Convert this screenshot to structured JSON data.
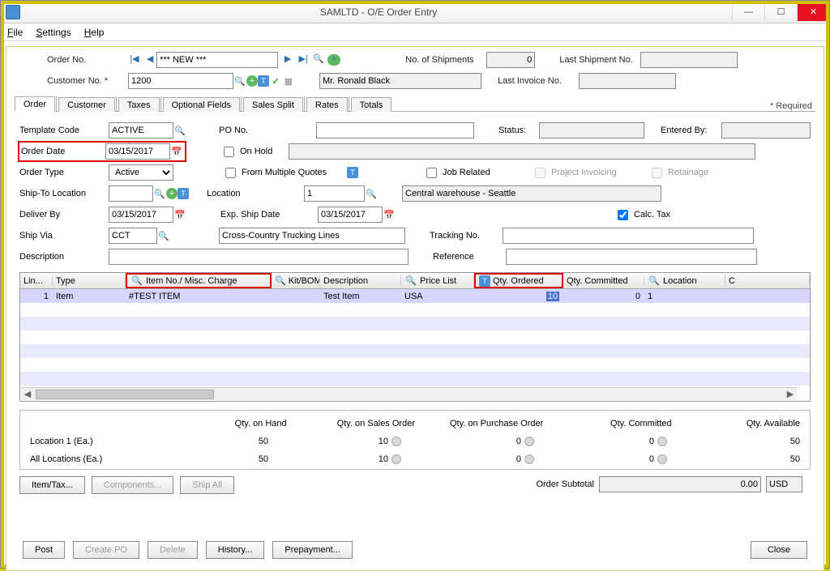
{
  "window": {
    "title": "SAMLTD - O/E Order Entry"
  },
  "menu": {
    "file": "File",
    "settings": "Settings",
    "help": "Help"
  },
  "header": {
    "order_no_label": "Order No.",
    "order_no_value": "*** NEW ***",
    "shipments_label": "No. of Shipments",
    "shipments_value": "0",
    "last_shipment_label": "Last Shipment No.",
    "last_shipment_value": "",
    "customer_no_label": "Customer No. *",
    "customer_no_value": "1200",
    "customer_name": "Mr. Ronald Black",
    "last_invoice_label": "Last Invoice No.",
    "last_invoice_value": ""
  },
  "required_label": "* Required",
  "tabs": [
    "Order",
    "Customer",
    "Taxes",
    "Optional Fields",
    "Sales Split",
    "Rates",
    "Totals"
  ],
  "order_tab": {
    "template_code_label": "Template Code",
    "template_code_value": "ACTIVE",
    "po_no_label": "PO No.",
    "po_no_value": "",
    "status_label": "Status:",
    "status_value": "",
    "entered_by_label": "Entered By:",
    "entered_by_value": "",
    "order_date_label": "Order Date",
    "order_date_value": "03/15/2017",
    "on_hold_label": "On Hold",
    "on_hold_value": "",
    "order_type_label": "Order Type",
    "order_type_value": "Active",
    "from_multiple_label": "From Multiple Quotes",
    "job_related_label": "Job Related",
    "project_invoicing_label": "Project Invoicing",
    "retainage_label": "Retainage",
    "ship_to_label": "Ship-To Location",
    "ship_to_value": "",
    "location_label": "Location",
    "location_value": "1",
    "location_name": "Central warehouse - Seattle",
    "deliver_by_label": "Deliver By",
    "deliver_by_value": "03/15/2017",
    "exp_ship_label": "Exp. Ship Date",
    "exp_ship_value": "03/15/2017",
    "calc_tax_label": "Calc. Tax",
    "ship_via_label": "Ship Via",
    "ship_via_value": "CCT",
    "ship_via_name": "Cross-Country Trucking Lines",
    "tracking_label": "Tracking No.",
    "tracking_value": "",
    "description_label": "Description",
    "description_value": "",
    "reference_label": "Reference",
    "reference_value": ""
  },
  "grid": {
    "columns": [
      "Lin...",
      "Type",
      "Item No./ Misc. Charge",
      "Kit/BOM",
      "Description",
      "Price List",
      "Qty. Ordered",
      "Qty. Committed",
      "Location",
      "C"
    ],
    "row": {
      "line": "1",
      "type": "Item",
      "item_no": "#TEST ITEM",
      "kit": "",
      "desc": "Test Item",
      "price_list": "USA",
      "qty_ordered": "10",
      "qty_committed": "0",
      "location": "1"
    }
  },
  "summary": {
    "headers": [
      "Qty. on Hand",
      "Qty. on Sales Order",
      "Qty. on Purchase Order",
      "Qty. Committed",
      "Qty. Available"
    ],
    "row1_label": "Location 1 (Ea.)",
    "row2_label": "All Locations (Ea.)",
    "row1": [
      "50",
      "10",
      "0",
      "0",
      "50"
    ],
    "row2": [
      "50",
      "10",
      "0",
      "0",
      "50"
    ]
  },
  "buttons": {
    "item_tax": "Item/Tax...",
    "components": "Components...",
    "ship_all": "Ship All",
    "subtotal_label": "Order Subtotal",
    "subtotal_value": "0.00",
    "currency": "USD",
    "post": "Post",
    "create_po": "Create PO",
    "delete": "Delete",
    "history": "History...",
    "prepayment": "Prepayment...",
    "close": "Close"
  }
}
